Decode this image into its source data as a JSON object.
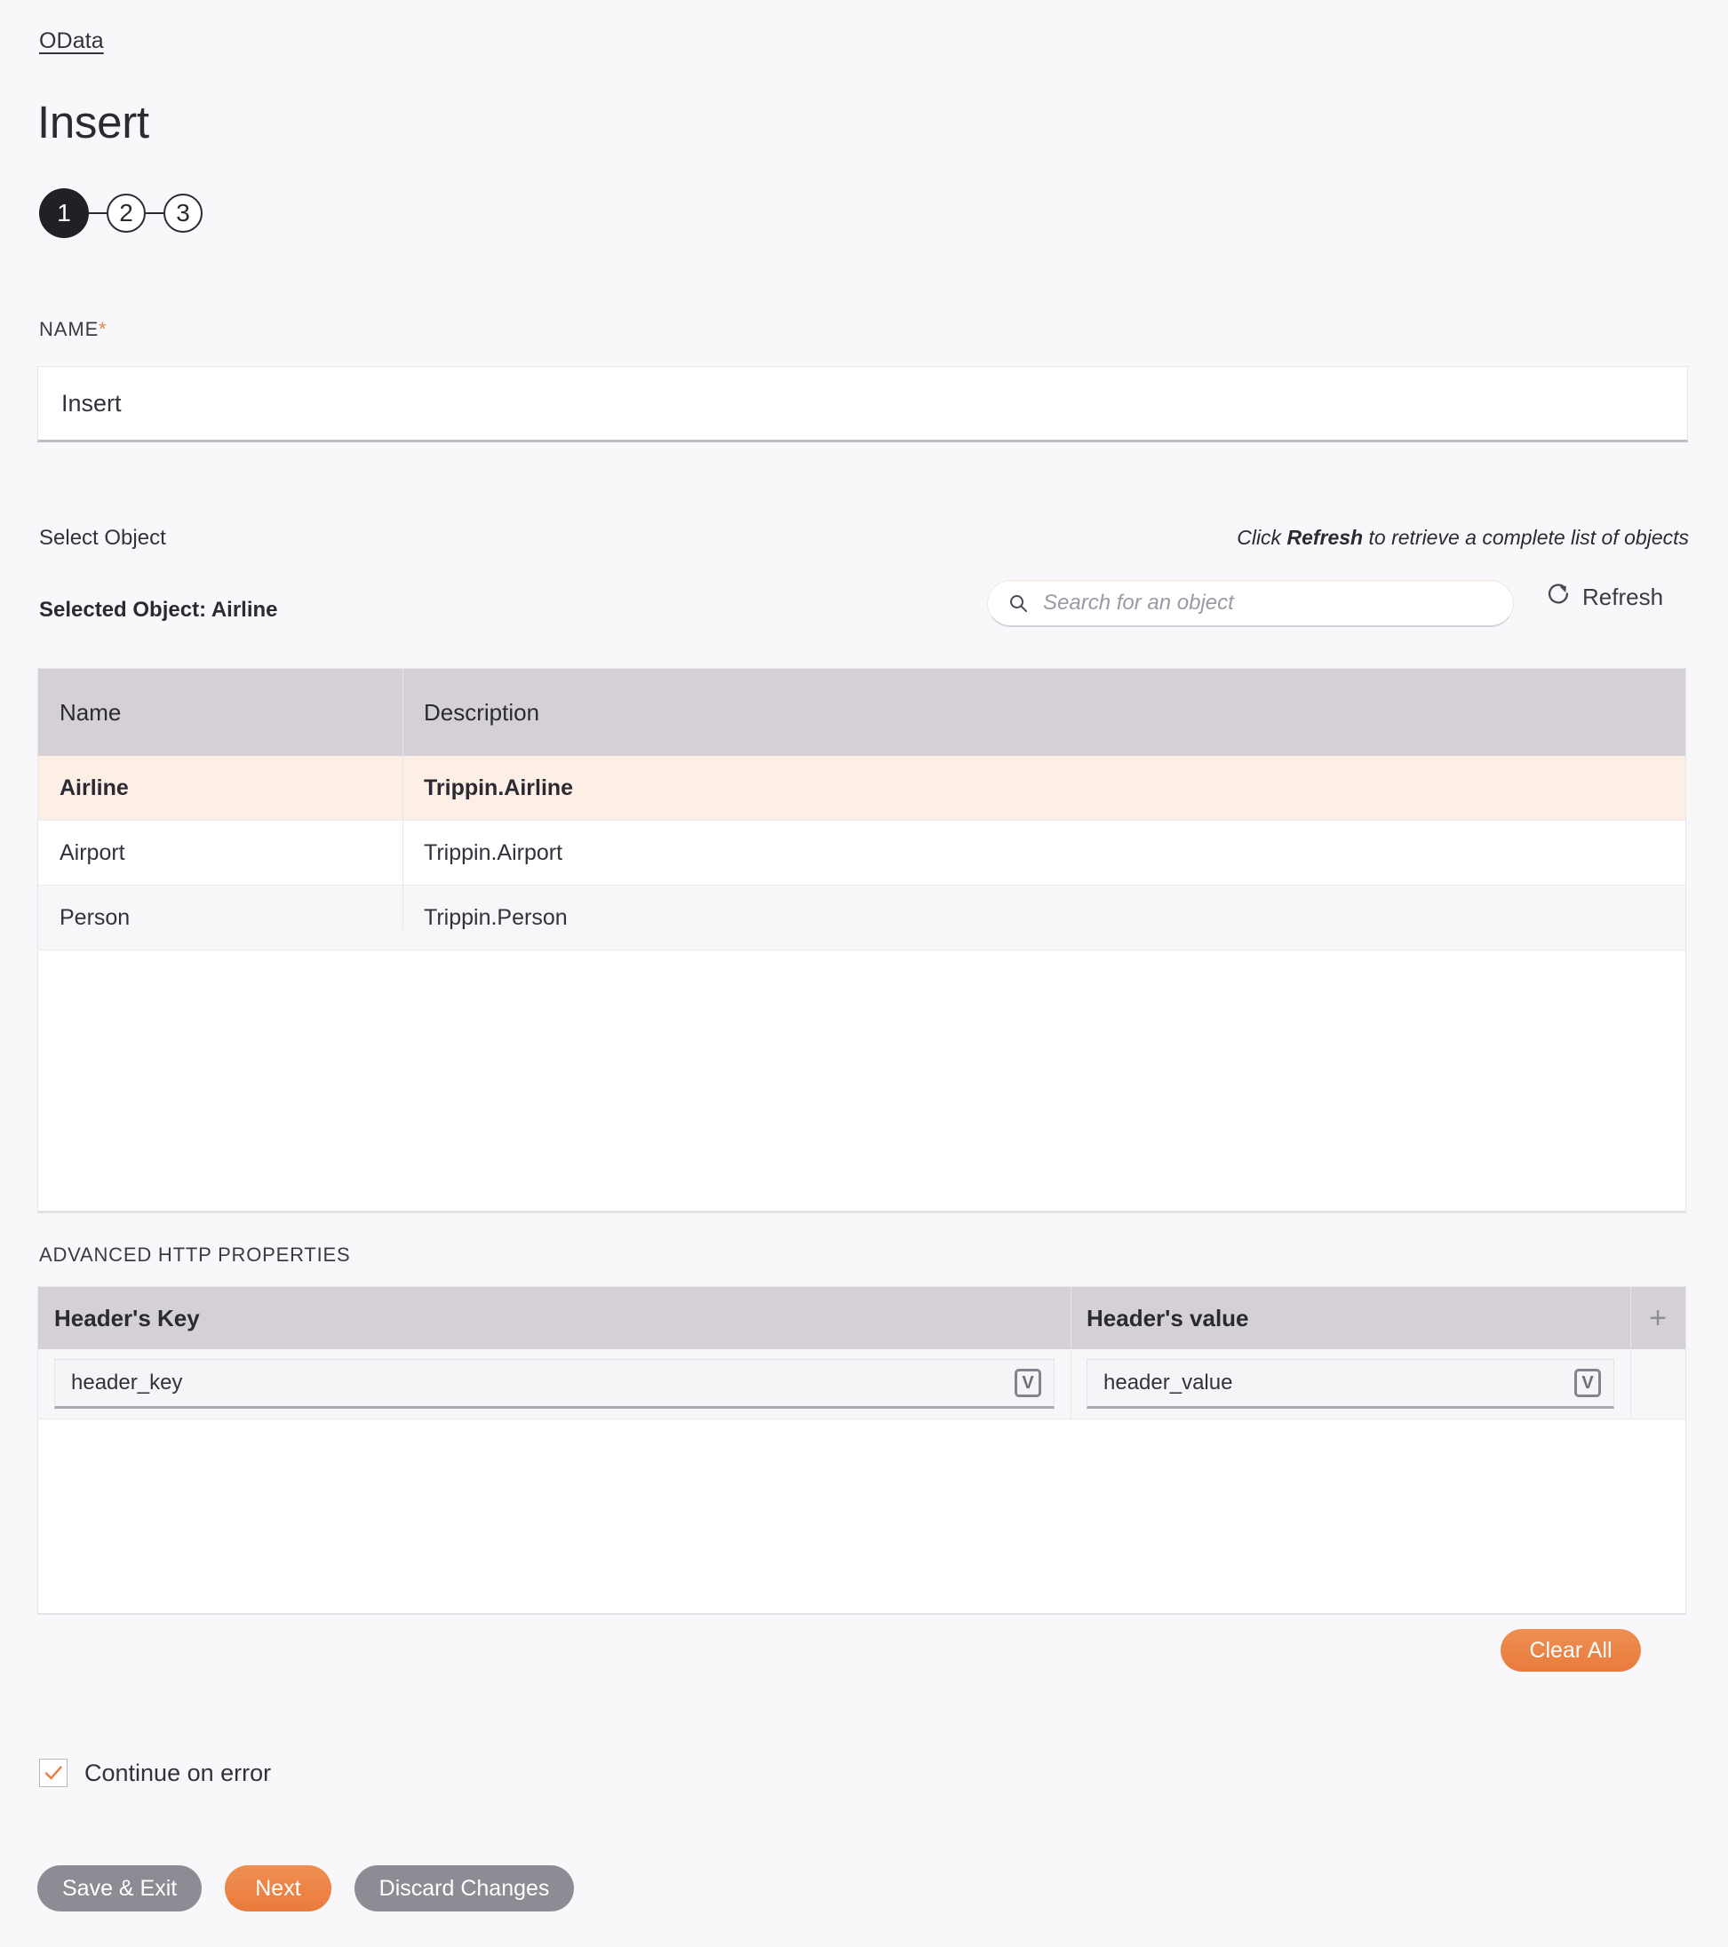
{
  "breadcrumb": {
    "label": "OData"
  },
  "header": {
    "title": "Insert"
  },
  "stepper": {
    "steps": [
      {
        "number": "1",
        "state": "active"
      },
      {
        "number": "2",
        "state": "idle"
      },
      {
        "number": "3",
        "state": "idle"
      }
    ]
  },
  "name_field": {
    "label": "NAME",
    "required_marker": "*",
    "value": "Insert"
  },
  "select_object": {
    "section_label": "Select Object",
    "hint_prefix": "Click ",
    "hint_bold": "Refresh",
    "hint_suffix": " to retrieve a complete list of objects",
    "selected_label": "Selected Object: Airline",
    "search": {
      "placeholder": "Search for an object",
      "value": "",
      "icon": "search-icon"
    },
    "refresh": {
      "label": "Refresh",
      "icon": "refresh-icon"
    },
    "table": {
      "columns": [
        "Name",
        "Description"
      ],
      "rows": [
        {
          "name": "Airline",
          "description": "Trippin.Airline",
          "selected": true
        },
        {
          "name": "Airport",
          "description": "Trippin.Airport",
          "selected": false
        },
        {
          "name": "Person",
          "description": "Trippin.Person",
          "selected": false
        }
      ]
    }
  },
  "advanced_http": {
    "section_label": "ADVANCED HTTP PROPERTIES",
    "columns": [
      "Header's Key",
      "Header's value"
    ],
    "add_icon": "plus-icon",
    "rows": [
      {
        "key": "header_key",
        "key_picker_icon": "variable-picker-icon",
        "key_picker_glyph": "V",
        "value": "header_value",
        "value_picker_icon": "variable-picker-icon",
        "value_picker_glyph": "V"
      }
    ],
    "clear_all_label": "Clear All"
  },
  "continue_on_error": {
    "label": "Continue on error",
    "checked": true,
    "icon": "check-icon"
  },
  "footer": {
    "save_exit_label": "Save & Exit",
    "next_label": "Next",
    "discard_label": "Discard Changes"
  },
  "colors": {
    "page_background": "#f8f8fa",
    "accent_orange": "#e97b3c",
    "table_header": "#d4d0d6",
    "selected_row": "#fdeee6",
    "button_grey": "#8c8c94",
    "step_active": "#231f26"
  }
}
